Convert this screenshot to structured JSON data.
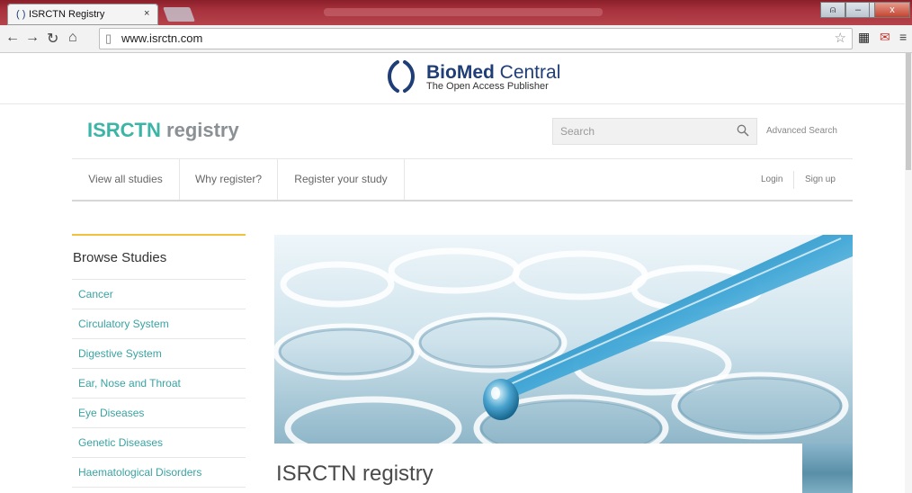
{
  "browser": {
    "tab_title": "ISRCTN Registry",
    "tab_close": "×",
    "url": "www.isrctn.com",
    "controls": {
      "minimize": "–",
      "maximize": "□",
      "close": "x"
    }
  },
  "publisher": {
    "name_bold": "BioMed",
    "name_rest": " Central",
    "tagline": "The Open Access Publisher"
  },
  "site": {
    "logo_part1": "ISRCTN",
    "logo_part2": "registry",
    "search_placeholder": "Search",
    "advanced_search": "Advanced Search"
  },
  "nav": {
    "items": [
      "View all studies",
      "Why register?",
      "Register your study"
    ],
    "login": "Login",
    "signup": "Sign up"
  },
  "sidebar": {
    "title": "Browse Studies",
    "items": [
      "Cancer",
      "Circulatory System",
      "Digestive System",
      "Ear, Nose and Throat",
      "Eye Diseases",
      "Genetic Diseases",
      "Haematological Disorders"
    ]
  },
  "hero": {
    "caption": "ISRCTN registry"
  },
  "colors": {
    "accent_teal": "#3cb4a6",
    "brand_navy": "#1f3e78",
    "sidebar_rule": "#f0c33c",
    "chrome_frame": "#a8323d"
  }
}
